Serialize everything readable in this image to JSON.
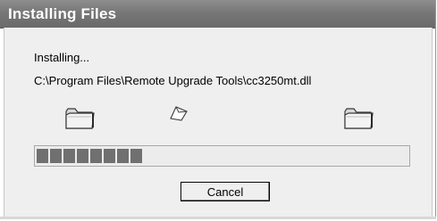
{
  "window": {
    "title": "Installing Files"
  },
  "status": {
    "label": "Installing...",
    "file_path": "C:\\Program Files\\Remote Upgrade Tools\\cc3250mt.dll"
  },
  "progress": {
    "fraction": 0.35,
    "filled_blocks": 8
  },
  "buttons": {
    "cancel_label": "Cancel"
  },
  "icons": {
    "source": "folder-icon",
    "destination": "folder-icon",
    "animation": "flying-document-icon"
  },
  "colors": {
    "titlebar": "#777777",
    "client_background": "#efefef",
    "progress_block": "#707070"
  }
}
